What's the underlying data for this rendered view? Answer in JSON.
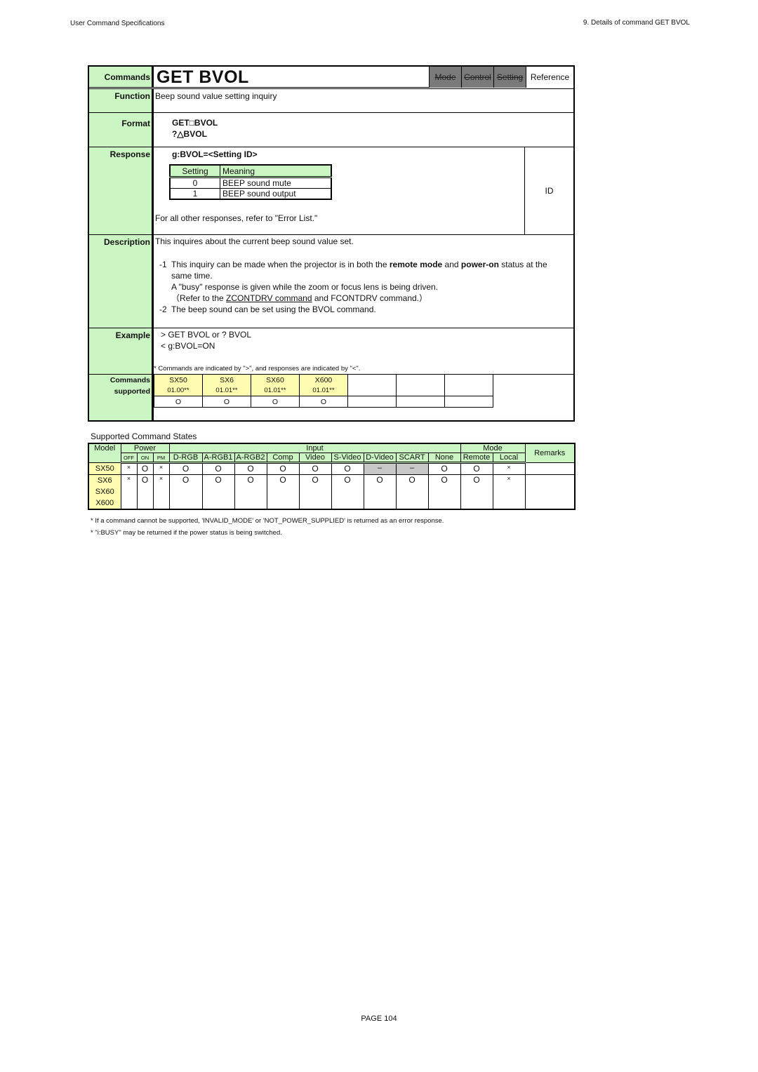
{
  "page_header": {
    "left": "User Command Specifications",
    "right": "9. Details of command  GET BVOL"
  },
  "spec": {
    "labels": {
      "commands": "Commands",
      "function": "Function",
      "format": "Format",
      "response": "Response",
      "description": "Description",
      "example": "Example",
      "supported_1": "Commands",
      "supported_2": "supported"
    },
    "title": "GET BVOL",
    "mode_cells": {
      "mode": "Mode",
      "control": "Control",
      "setting": "Setting",
      "reference": "Reference"
    },
    "function_text": "Beep sound value setting inquiry",
    "format_lines": [
      "GET□BVOL",
      "?△BVOL"
    ],
    "response": {
      "command": "g:BVOL=<Setting ID>",
      "table_headers": [
        "Setting",
        "Meaning"
      ],
      "table_rows": [
        {
          "setting": "0",
          "meaning": "BEEP sound mute"
        },
        {
          "setting": "1",
          "meaning": "BEEP sound output"
        }
      ],
      "note": "For all other responses, refer to \"Error List.\"",
      "side_label": "ID"
    },
    "description": {
      "intro": "This inquires about the current beep sound value set.",
      "item1_num": "-1",
      "item1_a": "This inquiry can be made when the projector is in both the ",
      "item1_bold1": "remote mode",
      "item1_b": " and ",
      "item1_bold2": "power-on",
      "item1_c": " status at the same time.",
      "item1_line2": "A \"busy\" response is given while the zoom or focus lens is being driven.",
      "item1_line3_a": "（Refer to the ",
      "item1_line3_link": "ZCONTDRV command",
      "item1_line3_b": " and FCONTDRV command.）",
      "item2_num": "-2",
      "item2": "The beep sound can be set using the BVOL command."
    },
    "example": {
      "lines": [
        "> GET BVOL or ? BVOL",
        "< g:BVOL=ON"
      ],
      "note": "* Commands are indicated by \">\", and responses are indicated by \"<\"."
    },
    "supported": {
      "models": [
        "SX50",
        "SX6",
        "SX60",
        "X600",
        "",
        "",
        ""
      ],
      "versions": [
        "01.00**",
        "01.01**",
        "01.01**",
        "01.01**",
        "",
        "",
        ""
      ],
      "marks": [
        "O",
        "O",
        "O",
        "O",
        "",
        "",
        ""
      ]
    }
  },
  "states": {
    "title": "Supported Command States",
    "headers": {
      "model": "Model",
      "power": "Power",
      "input": "Input",
      "mode": "Mode",
      "remarks": "Remarks",
      "power_cols": [
        "OFF",
        "ON",
        "PM"
      ],
      "input_cols": [
        "D-RGB",
        "A-RGB1",
        "A-RGB2",
        "Comp",
        "Video",
        "S-Video",
        "D-Video",
        "SCART",
        "None"
      ],
      "mode_cols": [
        "Remote",
        "Local"
      ]
    },
    "rows": [
      {
        "models": [
          "SX50"
        ],
        "values": [
          "×",
          "O",
          "×",
          "O",
          "O",
          "O",
          "O",
          "O",
          "O",
          "–",
          "–",
          "O",
          "O",
          "×"
        ],
        "remarks": ""
      },
      {
        "models": [
          "SX6",
          "SX60",
          "X600"
        ],
        "values": [
          "×",
          "O",
          "×",
          "O",
          "O",
          "O",
          "O",
          "O",
          "O",
          "O",
          "O",
          "O",
          "O",
          "×"
        ],
        "remarks": ""
      }
    ],
    "notes": [
      "* If a command cannot be supported, 'INVALID_MODE' or 'NOT_POWER_SUPPLIED' is returned as an error response.",
      "* \"i:BUSY\" may be returned if the power status is being switched."
    ]
  },
  "footer": {
    "page": "PAGE 104"
  },
  "colors": {
    "label_green": "#ccf5c4",
    "model_yellow": "#fdfbb0",
    "disabled_gray": "#7a7a7a",
    "na_gray": "#c8c8c8"
  }
}
